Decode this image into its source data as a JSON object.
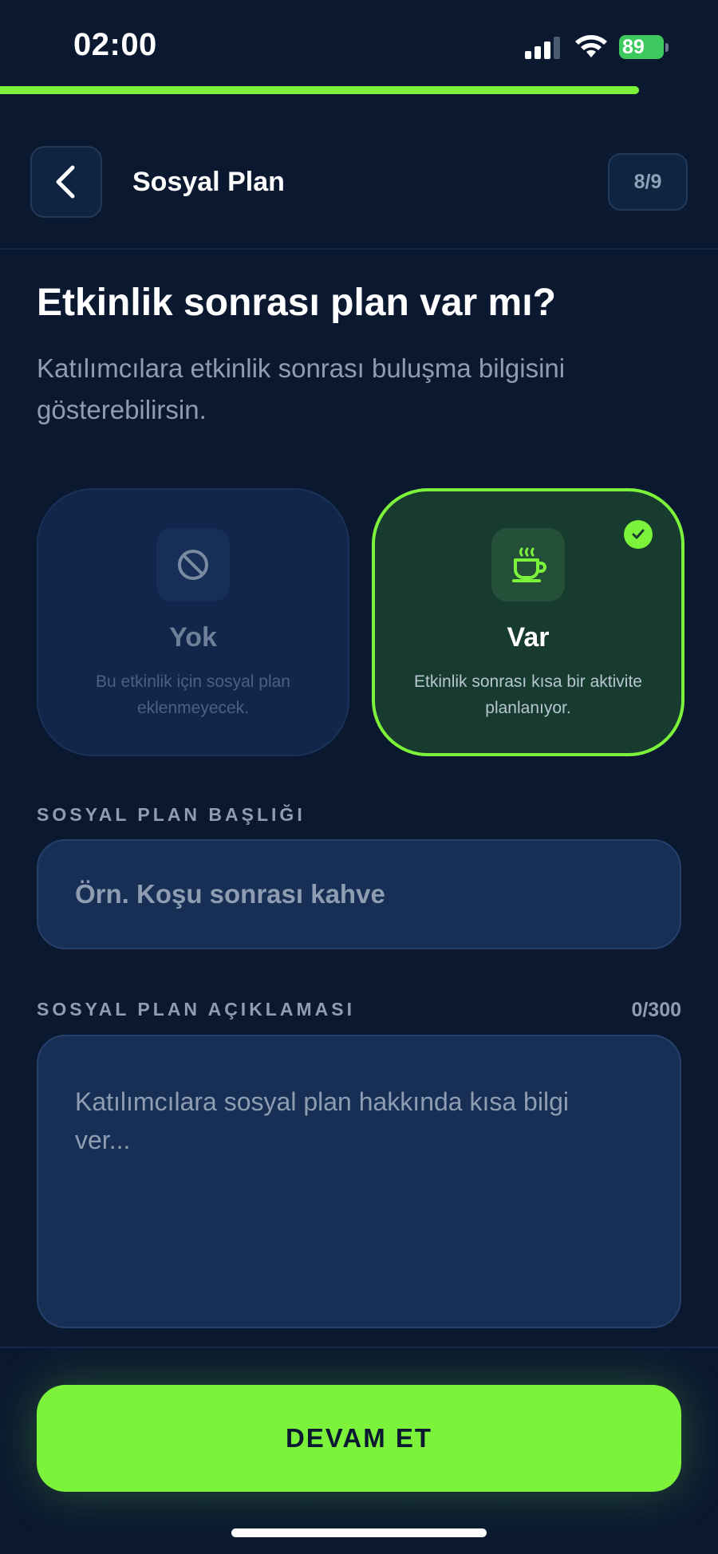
{
  "status_bar": {
    "time": "02:00",
    "battery_level": "89",
    "icons": [
      "signal-icon",
      "wifi-icon",
      "battery-icon"
    ]
  },
  "progress": {
    "value": 0.89
  },
  "header": {
    "title": "Sosyal Plan",
    "step": "8/9",
    "back_icon": "chevron-left-icon"
  },
  "main": {
    "title": "Etkinlik sonrası plan var mı?",
    "subtitle": "Katılımcılara etkinlik sonrası buluşma bilgisini gösterebilirsin."
  },
  "options": [
    {
      "title": "Yok",
      "description": "Bu etkinlik için sosyal plan eklenmeyecek.",
      "icon": "prohibited-icon",
      "selected": false
    },
    {
      "title": "Var",
      "description": "Etkinlik sonrası kısa bir aktivite planlanıyor.",
      "icon": "coffee-cup-icon",
      "selected": true
    }
  ],
  "form": {
    "title_label": "SOSYAL PLAN BAŞLIĞI",
    "title_placeholder": "Örn. Koşu sonrası kahve",
    "title_value": "",
    "description_label": "SOSYAL PLAN AÇIKLAMASI",
    "char_counter": "0/300",
    "description_placeholder": "Katılımcılara sosyal plan hakkında kısa bilgi ver...",
    "description_value": ""
  },
  "footer": {
    "continue_label": "DEVAM ET"
  },
  "colors": {
    "background": "#0b1930",
    "accent": "#7cf33a",
    "card_selected": "#173b2e",
    "muted_text": "#8f9db2"
  }
}
